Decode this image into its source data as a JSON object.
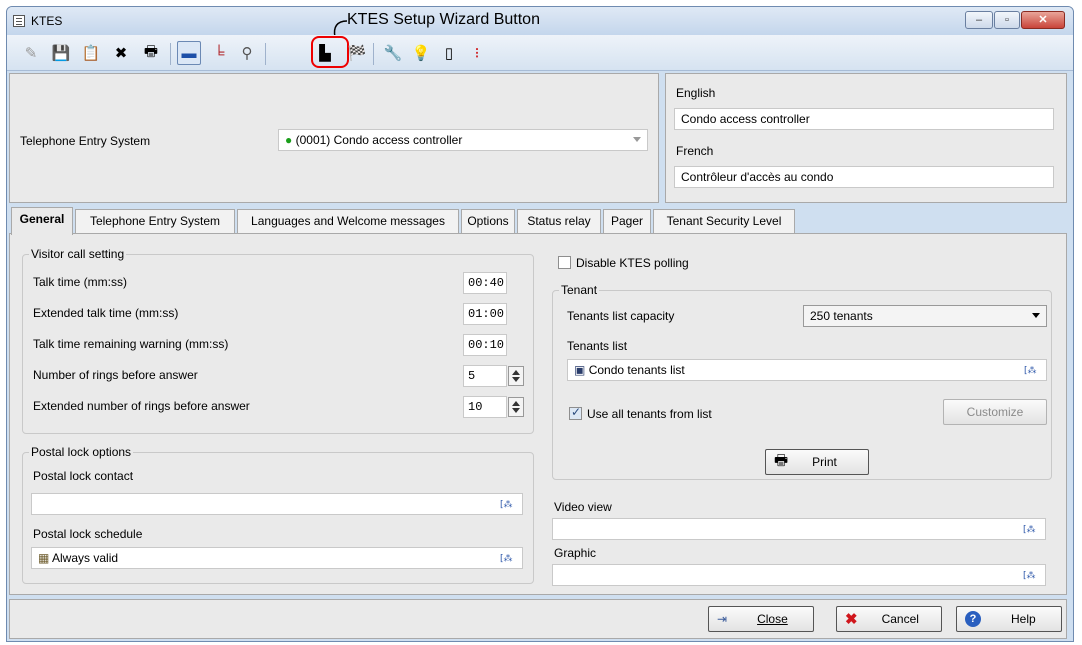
{
  "window": {
    "title": "KTES",
    "controls": [
      "minimize",
      "maximize",
      "close"
    ]
  },
  "annotation": {
    "text": "KTES Setup Wizard Button"
  },
  "toolbar": {
    "icons": [
      "new-icon",
      "save-icon",
      "save-as-icon",
      "delete-icon",
      "print-icon",
      "panel-icon",
      "link-icon",
      "search-icon",
      "setup-wizard-icon",
      "checkered-flag-icon",
      "tools-icon",
      "lightbulb-icon",
      "door-icon",
      "traffic-light-icon"
    ]
  },
  "header": {
    "label": "Telephone Entry System",
    "selected_value": "(0001) Condo access controller",
    "status_color": "#1a9e1a"
  },
  "languages": {
    "english_label": "English",
    "english_value": "Condo access controller",
    "french_label": "French",
    "french_value": "Contrôleur d'accès au condo"
  },
  "tabs": [
    {
      "label": "General",
      "active": true
    },
    {
      "label": "Telephone Entry System"
    },
    {
      "label": "Languages and Welcome messages"
    },
    {
      "label": "Options"
    },
    {
      "label": "Status relay"
    },
    {
      "label": "Pager"
    },
    {
      "label": "Tenant Security Level"
    }
  ],
  "visitor_call": {
    "title": "Visitor call setting",
    "talk_time_label": "Talk time (mm:ss)",
    "talk_time": "00:40",
    "extended_talk_label": "Extended talk time (mm:ss)",
    "extended_talk": "01:00",
    "warning_label": "Talk time remaining warning (mm:ss)",
    "warning": "00:10",
    "rings_label": "Number of rings before answer",
    "rings": "5",
    "ext_rings_label": "Extended number of rings before answer",
    "ext_rings": "10"
  },
  "postal": {
    "title": "Postal lock options",
    "contact_label": "Postal lock contact",
    "contact_value": "",
    "schedule_label": "Postal lock schedule",
    "schedule_value": "Always valid"
  },
  "right": {
    "disable_polling_label": "Disable KTES polling",
    "disable_polling_checked": false,
    "tenant_title": "Tenant",
    "capacity_label": "Tenants list capacity",
    "capacity_value": "250 tenants",
    "tenants_list_label": "Tenants list",
    "tenants_list_value": "Condo tenants list",
    "use_all_label": "Use all tenants from list",
    "use_all_checked": true,
    "customize_label": "Customize",
    "print_label": "Print",
    "video_view_label": "Video view",
    "video_view_value": "",
    "graphic_label": "Graphic",
    "graphic_value": ""
  },
  "footer": {
    "close_label": "Close",
    "cancel_label": "Cancel",
    "help_label": "Help"
  }
}
